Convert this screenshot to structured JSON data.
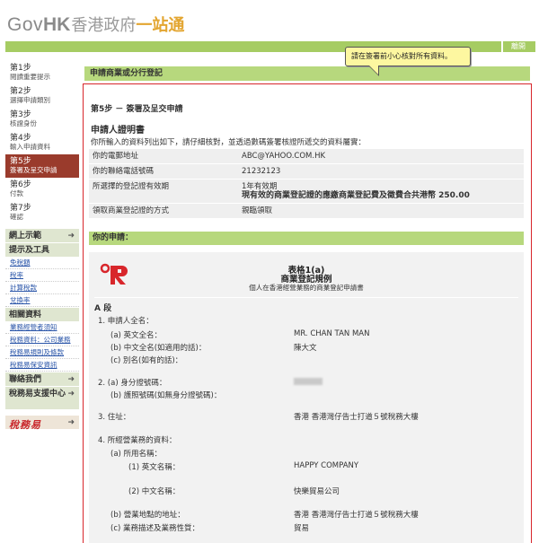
{
  "header": {
    "logo_gov": "Gov",
    "logo_hk": "HK",
    "logo_cn1": "香港政府",
    "logo_cn2": "一站通",
    "help_label": "離開"
  },
  "tooltip": {
    "text": "請在簽署前小心核對所有資料。"
  },
  "sidebar": {
    "steps": [
      {
        "num": "第1步",
        "label": "閱讀重要提示"
      },
      {
        "num": "第2步",
        "label": "選擇申請類別"
      },
      {
        "num": "第3步",
        "label": "核證身份"
      },
      {
        "num": "第4步",
        "label": "輸入申請資料"
      },
      {
        "num": "第5步",
        "label": "簽署及呈交申請",
        "active": true
      },
      {
        "num": "第6步",
        "label": "付款"
      },
      {
        "num": "第7步",
        "label": "確認"
      }
    ],
    "menu": {
      "online_demo": "網上示範",
      "hints_tools": "提示及工具",
      "sub1": [
        "免稅額",
        "稅率",
        "計算稅款",
        "兌換率"
      ],
      "related": "相關資料",
      "sub2": [
        "業務經營者須知",
        "稅務資料：公司業務",
        "稅務易規則及條款",
        "稅務易保安資訊"
      ],
      "contact": "聯絡我們",
      "support": "稅務易支援中心",
      "tax_logo": "稅務易"
    }
  },
  "main": {
    "title": "申請商業或分行登記",
    "step_title": "第5步 － 簽署及呈交申請",
    "section_title": "申請人證明書",
    "section_desc": "你所輸入的資料列出如下，請仔細核對，並透過數碼簽署核證所遞交的資料屬實：",
    "info": [
      {
        "key": "你的電郵地址",
        "value": "ABC@YAHOO.COM.HK"
      },
      {
        "key": "你的聯絡電話號碼",
        "value": "21232123"
      },
      {
        "key": "所選擇的登記證有效期",
        "value": "1年有效期",
        "value_bold": "現有效的商業登記證的應繳商業登記費及徵費合共港幣 250.00"
      },
      {
        "key": "領取商業登記證的方式",
        "value": "親臨領取"
      }
    ],
    "your_app": "你的申請："
  },
  "form": {
    "h1": "表格1(a)",
    "h2": "商業登記規例",
    "h3": "個人在香港經營業務的商業登記申請書",
    "part": "A 段",
    "q1": "1. 申請人全名：",
    "q1a": "(a) 英文全名：",
    "q1a_v": "MR. CHAN TAN MAN",
    "q1b": "(b) 中文全名(如適用的話)：",
    "q1b_v": "陳大文",
    "q1c": "(c) 別名(如有的話)：",
    "q2": "2. (a) 身分證號碼：",
    "q2b": "(b) 護照號碼(如無身分證號碼)：",
    "q3": "3. 住址：",
    "q3_v": "香港 香港灣仔告士打道５號稅務大樓",
    "q4": "4. 所經營業務的資料：",
    "q4a": "(a) 所用名稱：",
    "q4a1": "(1) 英文名稱：",
    "q4a1_v": "HAPPY COMPANY",
    "q4a2": "(2) 中文名稱：",
    "q4a2_v": "快樂貿易公司",
    "q4b": "(b) 營業地點的地址：",
    "q4b_v": "香港 香港灣仔告士打道５號稅務大樓",
    "q4c": "(c) 業務描述及業務性質：",
    "q4c_v": "貿易"
  }
}
